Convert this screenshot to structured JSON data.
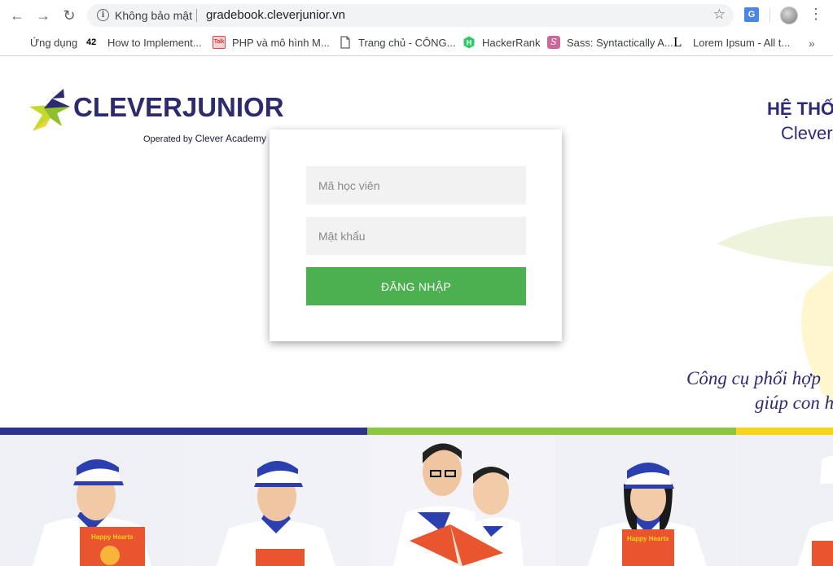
{
  "browser": {
    "security_label": "Không bảo mật",
    "url": "gradebook.cleverjunior.vn",
    "bookmarks": [
      {
        "label": "Ứng dụng",
        "icon": "apps-grid-icon"
      },
      {
        "label": "How to Implement...",
        "icon": "42-icon"
      },
      {
        "label": "PHP và mô hình M...",
        "icon": "talk-icon"
      },
      {
        "label": "Trang chủ - CÔNG...",
        "icon": "page-icon"
      },
      {
        "label": "HackerRank",
        "icon": "hackerrank-icon"
      },
      {
        "label": "Sass: Syntactically A...",
        "icon": "sass-icon"
      },
      {
        "label": "Lorem Ipsum - All t...",
        "icon": "lorem-icon"
      }
    ],
    "overflow_label": "»"
  },
  "logo": {
    "clever": "CLEVER",
    "junior": "JUNIOR",
    "operated_by": "Operated by",
    "academy": "Clever Academy"
  },
  "hero": {
    "title": "HỆ THỐ",
    "subtitle": "Clever",
    "tagline_line1": "Công cụ phối hợp",
    "tagline_line2": "giúp con h"
  },
  "login": {
    "student_id_placeholder": "Mã học viên",
    "password_placeholder": "Mật khẩu",
    "submit_label": "ĐĂNG NHẬP"
  },
  "colors": {
    "brand_navy": "#2d2a7a",
    "login_green": "#4caf50",
    "stripe_navy": "#2e3192",
    "stripe_lime": "#8dc63f",
    "stripe_yellow": "#f7d417",
    "field_bg": "#f2f2f2"
  }
}
